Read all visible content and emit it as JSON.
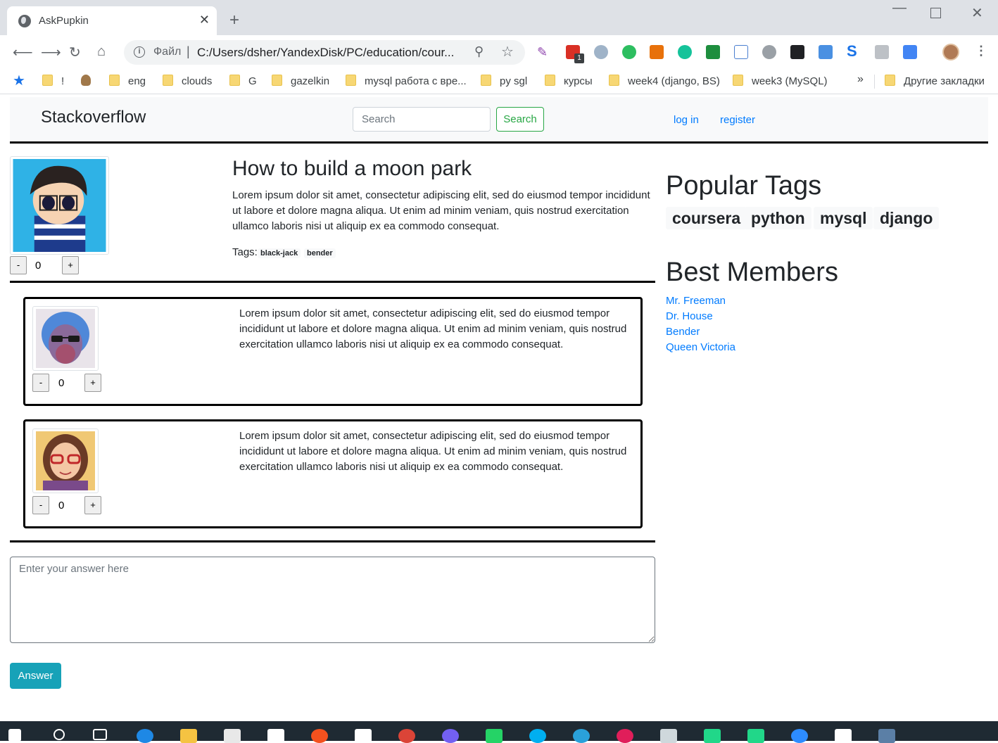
{
  "browser": {
    "tab_title": "AskPupkin",
    "tab_close": "✕",
    "new_tab": "+",
    "omnibox": {
      "file_label": "Файл",
      "separator": "|",
      "url": "C:/Users/dsher/YandexDisk/PC/education/cour..."
    },
    "bookmarks": [
      "!",
      "eng",
      "clouds",
      "G",
      "gazelkin",
      "mysql работа с вре...",
      "py sgl",
      "курсы",
      "week4 (django, BS)",
      "week3 (MySQL)"
    ],
    "bookmarks_more": "»",
    "other_bookmarks": "Другие закладки",
    "extension_badge": "1"
  },
  "site": {
    "brand": "Stackoverflow",
    "search_placeholder": "Search",
    "search_button": "Search",
    "nav": {
      "login": "log in",
      "register": "register"
    }
  },
  "question": {
    "title": "How to build a moon park",
    "body": "Lorem ipsum dolor sit amet, consectetur adipiscing elit, sed do eiusmod tempor incididunt ut labore et dolore magna aliqua. Ut enim ad minim veniam, quis nostrud exercitation ullamco laboris nisi ut aliquip ex ea commodo consequat.",
    "tags_label": "Tags:",
    "tags": [
      "black-jack",
      "bender"
    ],
    "votes": "0",
    "vote_minus": "-",
    "vote_plus": "+"
  },
  "answers": [
    {
      "body": "Lorem ipsum dolor sit amet, consectetur adipiscing elit, sed do eiusmod tempor incididunt ut labore et dolore magna aliqua. Ut enim ad minim veniam, quis nostrud exercitation ullamco laboris nisi ut aliquip ex ea commodo consequat.",
      "votes": "0"
    },
    {
      "body": "Lorem ipsum dolor sit amet, consectetur adipiscing elit, sed do eiusmod tempor incididunt ut labore et dolore magna aliqua. Ut enim ad minim veniam, quis nostrud exercitation ullamco laboris nisi ut aliquip ex ea commodo consequat.",
      "votes": "0"
    }
  ],
  "answer_form": {
    "placeholder": "Enter your answer here",
    "submit": "Answer"
  },
  "sidebar": {
    "popular_tags_title": "Popular Tags",
    "popular_tags": [
      "coursera",
      "python",
      "mysql",
      "django"
    ],
    "best_members_title": "Best Members",
    "members": [
      "Mr. Freeman",
      "Dr. House",
      "Bender",
      "Queen Victoria"
    ]
  },
  "colors": {
    "link": "#007bff",
    "search_button": "#28a745",
    "answer_button": "#17a2b8",
    "divider": "#000000"
  }
}
